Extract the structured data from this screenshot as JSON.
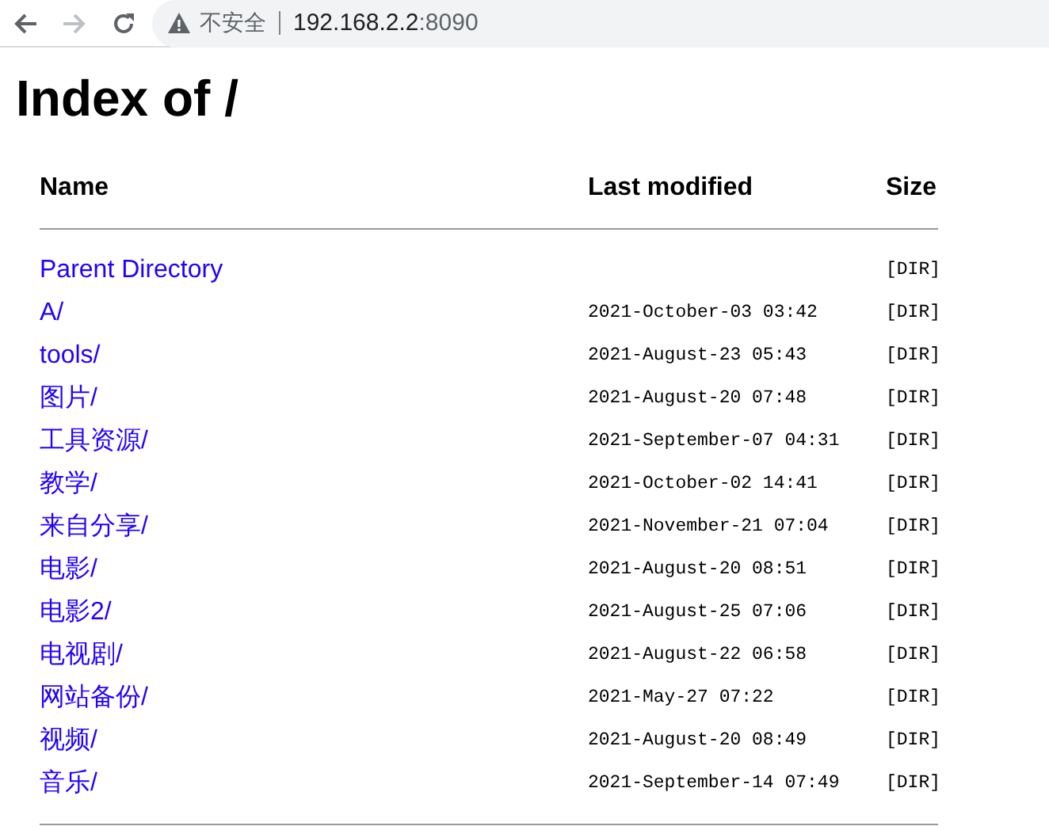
{
  "browser": {
    "security_label": "不安全",
    "address_host": "192.168.2.2",
    "address_port": ":8090"
  },
  "page": {
    "title": "Index of /",
    "columns": [
      "Name",
      "Last modified",
      "Size"
    ],
    "rows": [
      {
        "name": "Parent Directory",
        "modified": "",
        "size": "[DIR]"
      },
      {
        "name": "A/",
        "modified": "2021-October-03 03:42",
        "size": "[DIR]"
      },
      {
        "name": "tools/",
        "modified": "2021-August-23 05:43",
        "size": "[DIR]"
      },
      {
        "name": "图片/",
        "modified": "2021-August-20 07:48",
        "size": "[DIR]"
      },
      {
        "name": "工具资源/",
        "modified": "2021-September-07 04:31",
        "size": "[DIR]"
      },
      {
        "name": "教学/",
        "modified": "2021-October-02 14:41",
        "size": "[DIR]"
      },
      {
        "name": "来自分享/",
        "modified": "2021-November-21 07:04",
        "size": "[DIR]"
      },
      {
        "name": "电影/",
        "modified": "2021-August-20 08:51",
        "size": "[DIR]"
      },
      {
        "name": "电影2/",
        "modified": "2021-August-25 07:06",
        "size": "[DIR]"
      },
      {
        "name": "电视剧/",
        "modified": "2021-August-22 06:58",
        "size": "[DIR]"
      },
      {
        "name": "网站备份/",
        "modified": "2021-May-27 07:22",
        "size": "[DIR]"
      },
      {
        "name": "视频/",
        "modified": "2021-August-20 08:49",
        "size": "[DIR]"
      },
      {
        "name": "音乐/",
        "modified": "2021-September-14 07:49",
        "size": "[DIR]"
      }
    ]
  }
}
